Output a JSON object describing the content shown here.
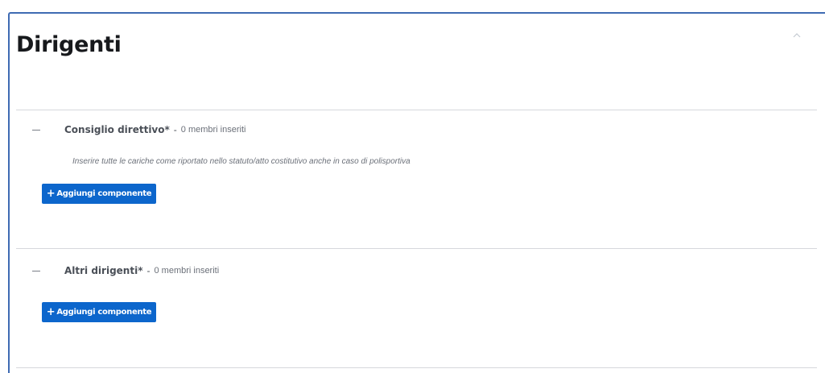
{
  "panel": {
    "title": "Dirigenti",
    "collapse_icon": "chevron-up-icon"
  },
  "sections": [
    {
      "title": "Consiglio direttivo*",
      "separator": "-",
      "count": "0 membri inseriti",
      "hint": "Inserire tutte le cariche come riportato nello statuto/atto costitutivo anche in caso di polisportiva",
      "add_button": {
        "icon": "+",
        "label": "Aggiungi componente"
      }
    },
    {
      "title": "Altri dirigenti*",
      "separator": "-",
      "count": "0 membri inseriti",
      "add_button": {
        "icon": "+",
        "label": "Aggiungi componente"
      }
    }
  ],
  "colors": {
    "accent": "#0c66cc",
    "panel_border": "#3f6bb3",
    "divider": "#d6d8dc"
  }
}
